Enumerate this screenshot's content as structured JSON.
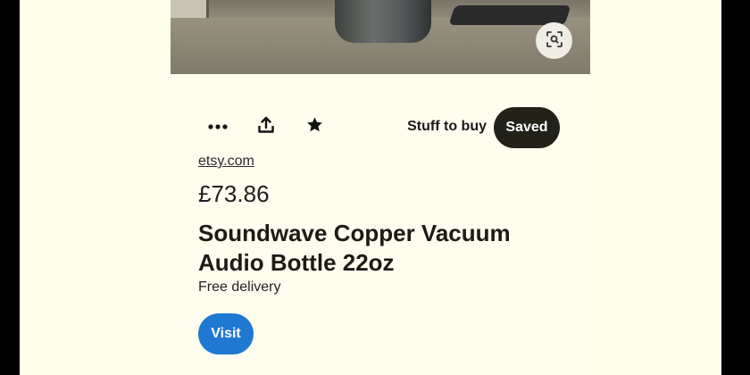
{
  "pin": {
    "source": "etsy.com",
    "price": "£73.86",
    "title": "Soundwave Copper Vacuum Audio Bottle 22oz",
    "delivery": "Free delivery"
  },
  "actions": {
    "more_icon": "more-horizontal-icon",
    "share_icon": "share-icon",
    "favorite_icon": "star-icon",
    "board_name": "Stuff to buy",
    "saved_label": "Saved",
    "visit_label": "Visit"
  },
  "colors": {
    "page_background": "#fefdec",
    "saved_button": "#232219",
    "visit_button": "#1f78d1"
  }
}
